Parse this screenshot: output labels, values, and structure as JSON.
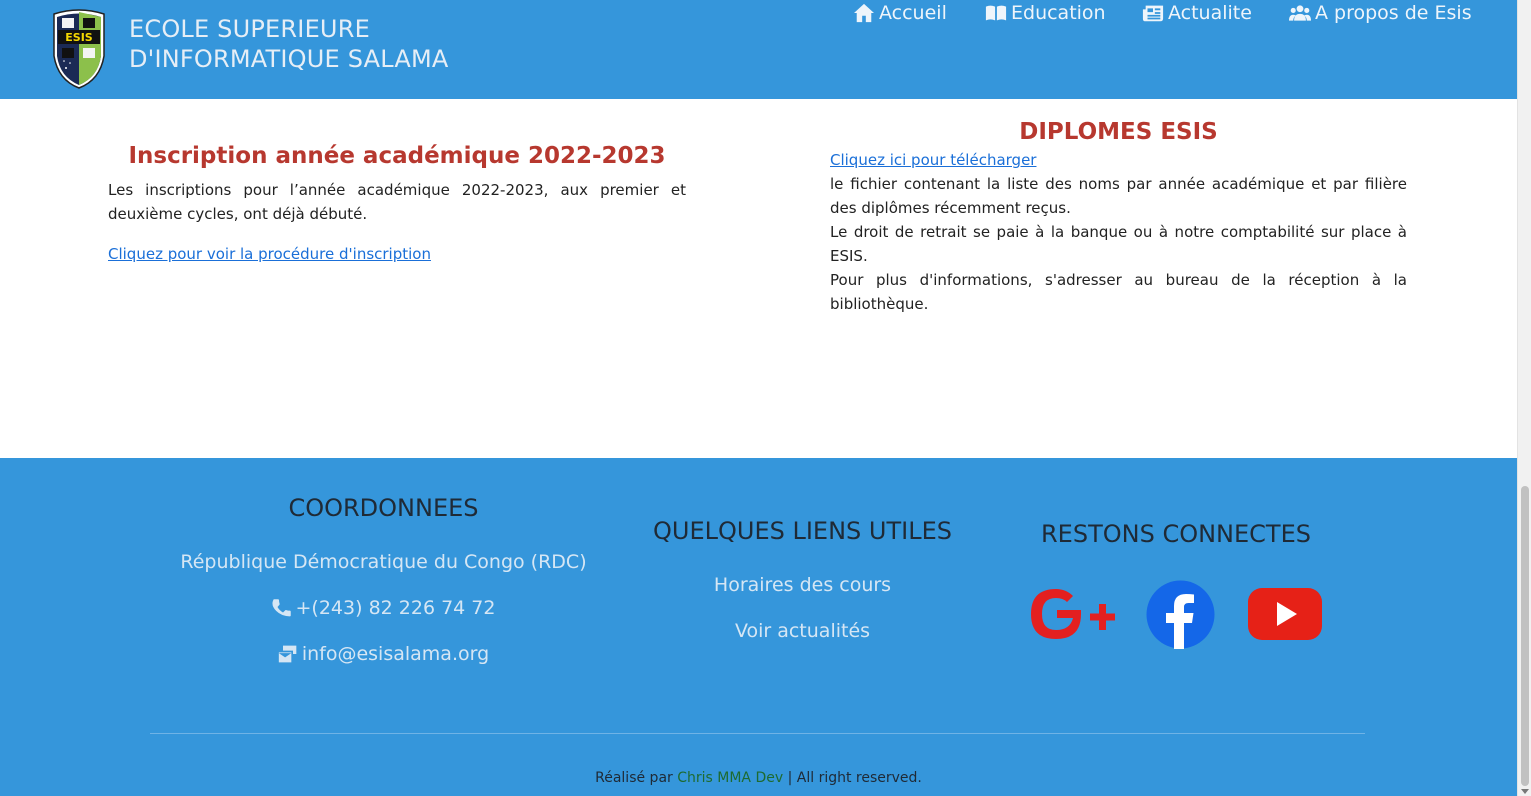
{
  "header": {
    "brand_line1": "ECOLE SUPERIEURE",
    "brand_line2": "D'INFORMATIQUE SALAMA",
    "logo_text": "ESIS",
    "nav": [
      {
        "label": "Accueil",
        "icon": "home-icon"
      },
      {
        "label": "Education",
        "icon": "book-icon"
      },
      {
        "label": "Actualite",
        "icon": "newspaper-icon"
      },
      {
        "label": "A propos de Esis",
        "icon": "users-icon"
      }
    ]
  },
  "left": {
    "title": "Inscription année académique 2022-2023",
    "text": "Les inscriptions pour l’année académique 2022-2023, aux premier et deuxième cycles, ont déjà débuté.",
    "link": "Cliquez pour voir la procédure d'inscription"
  },
  "right": {
    "title": "DIPLOMES ESIS",
    "link": "Cliquez ici pour télécharger",
    "line1": "le fichier contenant la liste des noms par année académique et par filière des diplômes récemment reçus.",
    "line2": "Le droit de retrait se paie à la banque ou à notre comptabilité sur place à ESIS.",
    "line3": "Pour plus d'informations, s'adresser au bureau de la réception à la bibliothèque."
  },
  "footer": {
    "coords": {
      "title": "COORDONNEES",
      "country": "République Démocratique du Congo (RDC)",
      "phone": "+(243) 82 226 74 72",
      "email": "info@esisalama.org"
    },
    "links": {
      "title": "QUELQUES LIENS UTILES",
      "items": [
        "Horaires des cours",
        "Voir actualités"
      ]
    },
    "social": {
      "title": "RESTONS CONNECTES",
      "google_color": "#e32020",
      "facebook_color": "#1467e8",
      "youtube_color": "#e62117"
    },
    "copyright_prefix": "Réalisé par",
    "developer": "Chris MMA Dev",
    "copyright_suffix": "| All right reserved."
  }
}
